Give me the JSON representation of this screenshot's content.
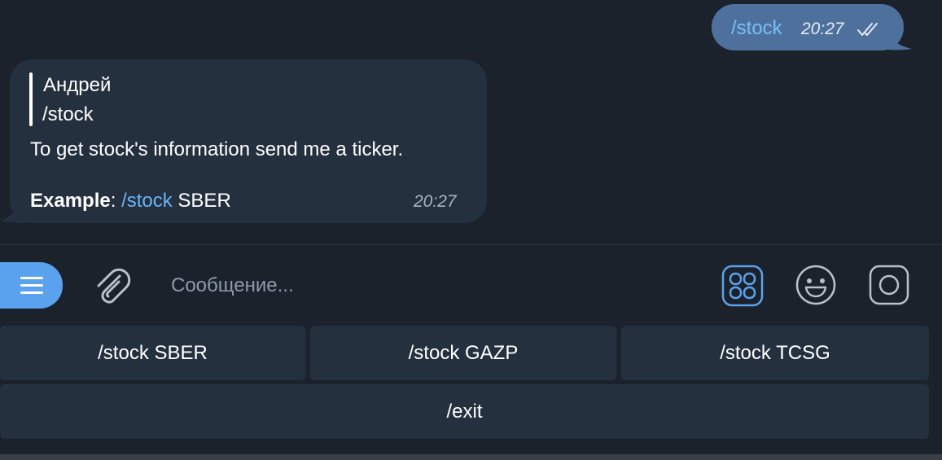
{
  "outgoing_message": {
    "text": "/stock",
    "time": "20:27",
    "status_icon": "double-check-icon"
  },
  "incoming_message": {
    "reply_author": "Андрей",
    "reply_text": "/stock",
    "line1": "To get stock's information send me a ticker.",
    "example_label": "Example",
    "example_colon": ": ",
    "example_command": "/stock",
    "example_ticker": " SBER",
    "time": "20:27"
  },
  "input_bar": {
    "menu_icon": "menu-icon",
    "attach_icon": "paperclip-icon",
    "placeholder": "Сообщение...",
    "keyboard_icon": "bot-keyboard-icon",
    "emoji_icon": "emoji-icon",
    "camera_icon": "camera-icon"
  },
  "keyboard": {
    "row1": [
      "/stock SBER",
      "/stock GAZP",
      "/stock TCSG"
    ],
    "row2": [
      "/exit"
    ]
  },
  "colors": {
    "background": "#1b222c",
    "outgoing_bubble": "#4e709c",
    "incoming_bubble": "#25303f",
    "link": "#68b4f5",
    "accent": "#5aa2ed"
  }
}
